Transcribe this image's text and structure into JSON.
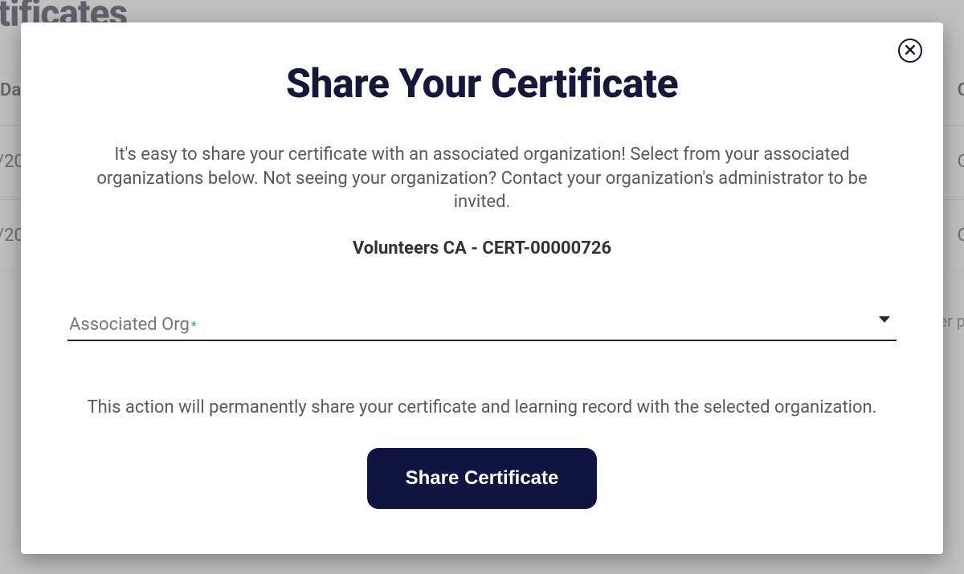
{
  "background": {
    "heading": "rtificates",
    "leftColLabel": "Da",
    "rightColChar": "C",
    "row1Left": "/20",
    "row2Left": "/20",
    "footerFrag": "er p"
  },
  "modal": {
    "title": "Share Your Certificate",
    "description": "It's easy to share your certificate with an associated organization! Select from your associated organizations below. Not seeing your organization? Contact your organization's administrator to be invited.",
    "certificateName": "Volunteers CA - CERT-00000726",
    "selectLabel": "Associated Org",
    "requiredMark": "*",
    "warning": "This action will permanently share your certificate and learning record with the selected organization.",
    "submitLabel": "Share Certificate"
  },
  "colors": {
    "primary": "#0f1440",
    "accent": "#16b37c"
  }
}
